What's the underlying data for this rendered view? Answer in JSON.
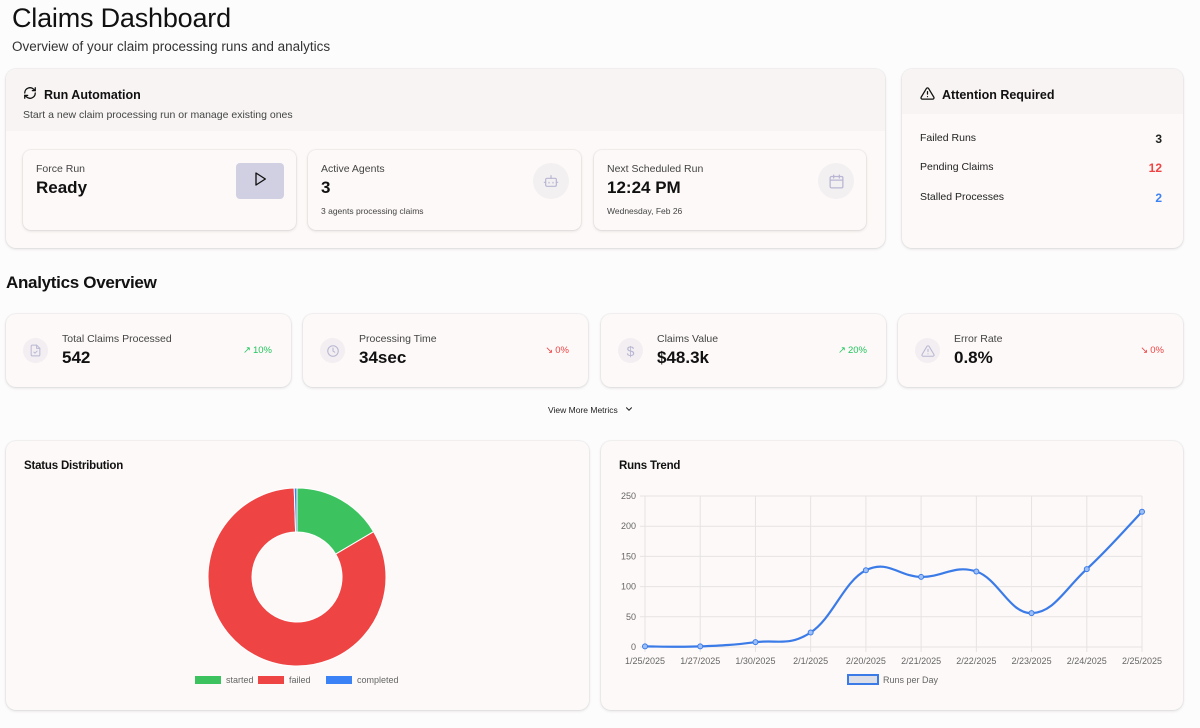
{
  "header": {
    "title": "Claims Dashboard",
    "subtitle": "Overview of your claim processing runs and analytics"
  },
  "run_automation": {
    "icon": "refresh-icon",
    "title": "Run Automation",
    "subtitle": "Start a new claim processing run or manage existing ones",
    "cards": [
      {
        "label": "Force Run",
        "value": "Ready",
        "sub": "",
        "icon": "play-icon"
      },
      {
        "label": "Active Agents",
        "value": "3",
        "sub": "3 agents processing claims",
        "icon": "bot-icon"
      },
      {
        "label": "Next Scheduled Run",
        "value": "12:24 PM",
        "sub": "Wednesday, Feb 26",
        "icon": "calendar-icon"
      }
    ]
  },
  "attention": {
    "icon": "warning-icon",
    "title": "Attention Required",
    "rows": [
      {
        "label": "Failed Runs",
        "value": "3",
        "color": "#222222"
      },
      {
        "label": "Pending Claims",
        "value": "12",
        "color": "#ef4444"
      },
      {
        "label": "Stalled Processes",
        "value": "2",
        "color": "#3b82f6"
      }
    ]
  },
  "analytics": {
    "title": "Analytics Overview",
    "metrics": [
      {
        "label": "Total Claims Processed",
        "value": "542",
        "change": "10%",
        "direction": "up",
        "icon": "file-check-icon"
      },
      {
        "label": "Processing Time",
        "value": "34sec",
        "change": "0%",
        "direction": "down",
        "icon": "clock-icon"
      },
      {
        "label": "Claims Value",
        "value": "$48.3k",
        "change": "20%",
        "direction": "up",
        "icon": "dollar-icon"
      },
      {
        "label": "Error Rate",
        "value": "0.8%",
        "change": "0%",
        "direction": "down",
        "icon": "warning-icon"
      }
    ],
    "view_more_label": "View More Metrics"
  },
  "colors": {
    "green": "#3cc35f",
    "red": "#ef4444",
    "blue": "#3b82f6",
    "line": "#3b7be8"
  },
  "chart_data": [
    {
      "type": "pie",
      "title": "Status Distribution",
      "donut": true,
      "categories": [
        "started",
        "failed",
        "completed"
      ],
      "values": [
        16.5,
        83.0,
        0.5
      ],
      "colors": [
        "#3cc35f",
        "#ef4444",
        "#3b82f6"
      ],
      "legend": "bottom"
    },
    {
      "type": "line",
      "title": "Runs Trend",
      "x": [
        "1/25/2025",
        "1/27/2025",
        "1/30/2025",
        "2/1/2025",
        "2/20/2025",
        "2/21/2025",
        "2/22/2025",
        "2/23/2025",
        "2/24/2025",
        "2/25/2025"
      ],
      "series": [
        {
          "name": "Runs per Day",
          "values": [
            1,
            1,
            8,
            24,
            127,
            116,
            125,
            56,
            129,
            224
          ]
        }
      ],
      "yticks": [
        0,
        50,
        100,
        150,
        200,
        250
      ],
      "ylim": [
        0,
        250
      ],
      "grid": true,
      "legend": "bottom"
    }
  ]
}
